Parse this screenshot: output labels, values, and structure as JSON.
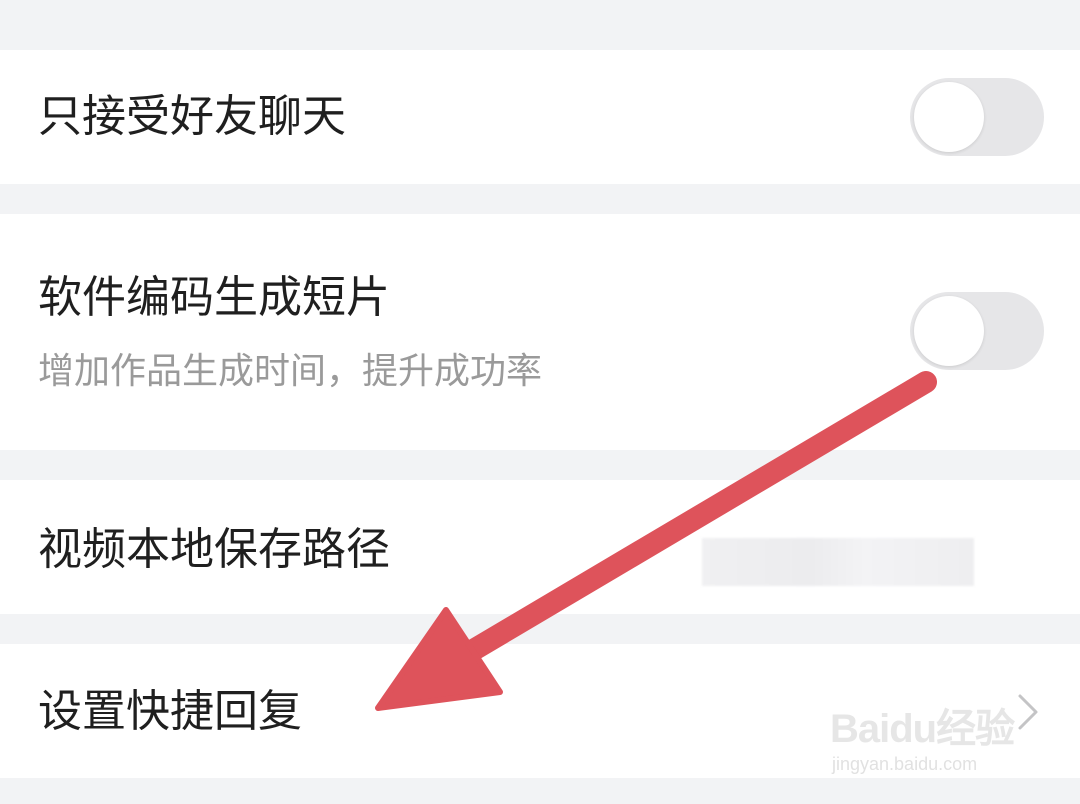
{
  "settings": {
    "friends_only_chat": {
      "label": "只接受好友聊天",
      "toggle_on": false
    },
    "software_encoding": {
      "label": "软件编码生成短片",
      "description": "增加作品生成时间，提升成功率",
      "toggle_on": false
    },
    "video_save_path": {
      "label": "视频本地保存路径"
    },
    "quick_reply": {
      "label": "设置快捷回复"
    }
  },
  "annotation": {
    "arrow_color": "#de535b"
  },
  "watermark": {
    "brand": "Baidu经验",
    "url": "jingyan.baidu.com"
  },
  "colors": {
    "background": "#f2f3f5",
    "row": "#ffffff",
    "toggle_off": "#e6e6e8",
    "text_primary": "#1f1f1f",
    "text_secondary": "#9a9a9a"
  }
}
